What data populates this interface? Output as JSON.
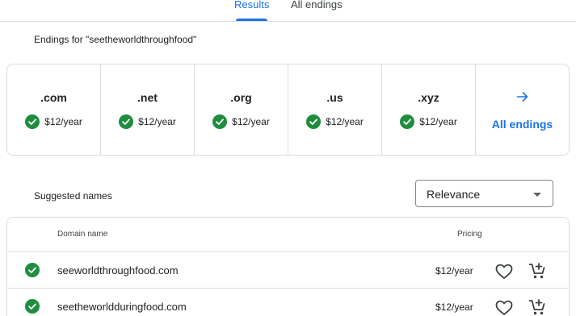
{
  "tabs": [
    {
      "label": "Results",
      "active": true
    },
    {
      "label": "All endings",
      "active": false
    }
  ],
  "endings_heading": "Endings for \"seetheworldthroughfood\"",
  "endings": [
    {
      "tld": ".com",
      "price": "$12/year",
      "available": true
    },
    {
      "tld": ".net",
      "price": "$12/year",
      "available": true
    },
    {
      "tld": ".org",
      "price": "$12/year",
      "available": true
    },
    {
      "tld": ".us",
      "price": "$12/year",
      "available": true
    },
    {
      "tld": ".xyz",
      "price": "$12/year",
      "available": true
    }
  ],
  "all_endings": {
    "label": "All endings",
    "icon": "arrow-right-icon"
  },
  "suggested_heading": "Suggested names",
  "sort": {
    "selected": "Relevance"
  },
  "results": {
    "columns": {
      "domain": "Domain name",
      "pricing": "Pricing"
    },
    "rows": [
      {
        "domain": "seeworldthroughfood.com",
        "price": "$12/year",
        "available": true
      },
      {
        "domain": "seetheworldduringfood.com",
        "price": "$12/year",
        "available": true
      }
    ]
  },
  "colors": {
    "accent": "#1a73e8",
    "available_green": "#1e8e3e",
    "border": "#dadce0"
  }
}
